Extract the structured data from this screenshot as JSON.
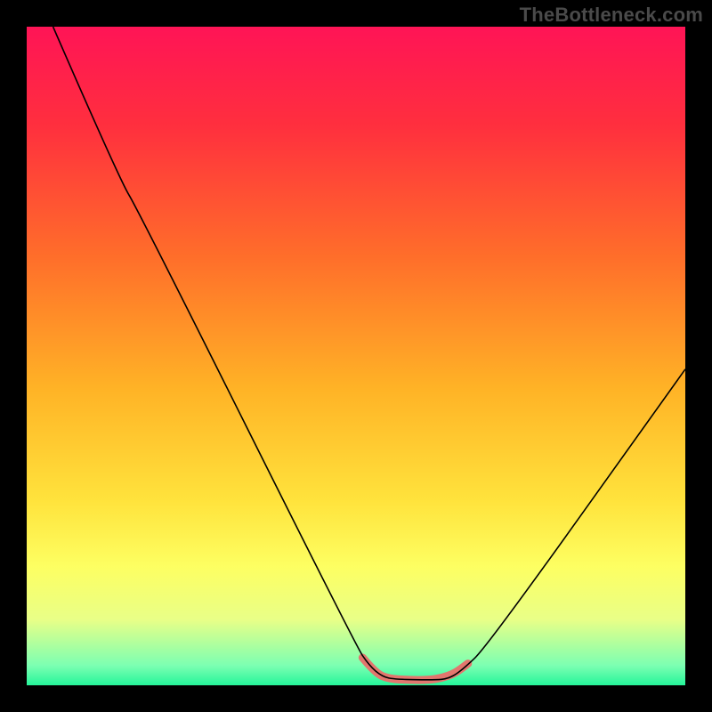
{
  "watermark": "TheBottleneck.com",
  "chart_data": {
    "type": "line",
    "title": "",
    "xlabel": "",
    "ylabel": "",
    "xlim": [
      0,
      100
    ],
    "ylim": [
      0,
      100
    ],
    "gradient_stops": [
      {
        "offset": 0,
        "color": "#ff1456"
      },
      {
        "offset": 15,
        "color": "#ff2f3e"
      },
      {
        "offset": 35,
        "color": "#ff6e2a"
      },
      {
        "offset": 55,
        "color": "#ffb326"
      },
      {
        "offset": 72,
        "color": "#ffe33c"
      },
      {
        "offset": 82,
        "color": "#fdff62"
      },
      {
        "offset": 90,
        "color": "#e9ff87"
      },
      {
        "offset": 97,
        "color": "#7cffb2"
      },
      {
        "offset": 100,
        "color": "#25f59a"
      }
    ],
    "series": [
      {
        "name": "curve",
        "stroke": "#000000",
        "stroke_width": 1.6,
        "points": [
          {
            "x": 4,
            "y": 100
          },
          {
            "x": 14,
            "y": 77
          },
          {
            "x": 17,
            "y": 72
          },
          {
            "x": 50,
            "y": 6
          },
          {
            "x": 52,
            "y": 3
          },
          {
            "x": 54,
            "y": 1.3
          },
          {
            "x": 56,
            "y": 0.9
          },
          {
            "x": 62,
            "y": 0.8
          },
          {
            "x": 64,
            "y": 1.0
          },
          {
            "x": 66,
            "y": 2.2
          },
          {
            "x": 70,
            "y": 6
          },
          {
            "x": 100,
            "y": 48
          }
        ]
      },
      {
        "name": "valley-highlight",
        "stroke": "#e2766e",
        "stroke_width": 9,
        "linecap": "round",
        "points": [
          {
            "x": 51,
            "y": 4.2
          },
          {
            "x": 53,
            "y": 1.8
          },
          {
            "x": 55,
            "y": 1.0
          },
          {
            "x": 58,
            "y": 0.8
          },
          {
            "x": 61,
            "y": 0.8
          },
          {
            "x": 63,
            "y": 1.1
          },
          {
            "x": 65,
            "y": 1.8
          },
          {
            "x": 67,
            "y": 3.3
          }
        ]
      }
    ]
  }
}
